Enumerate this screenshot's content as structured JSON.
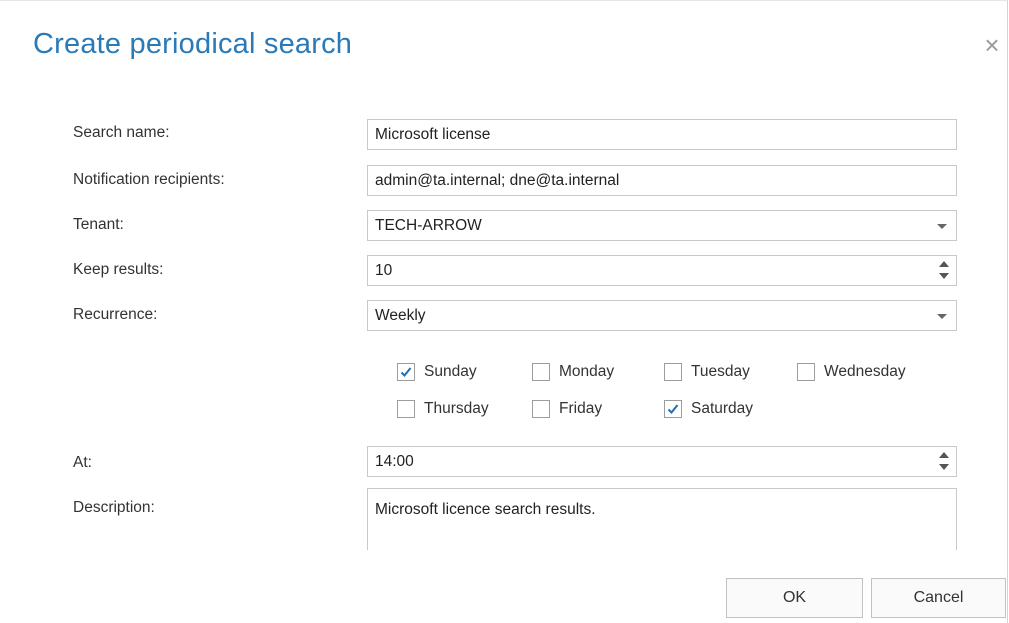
{
  "dialog": {
    "title": "Create periodical search",
    "close_glyph": "×"
  },
  "form": {
    "search_name": {
      "label": "Search name:",
      "value": "Microsoft license"
    },
    "recipients": {
      "label": "Notification recipients:",
      "value": "admin@ta.internal; dne@ta.internal"
    },
    "tenant": {
      "label": "Tenant:",
      "value": "TECH-ARROW"
    },
    "keep_results": {
      "label": "Keep results:",
      "value": "10"
    },
    "recurrence": {
      "label": "Recurrence:",
      "value": "Weekly"
    },
    "days": [
      {
        "label": "Sunday",
        "checked": true
      },
      {
        "label": "Monday",
        "checked": false
      },
      {
        "label": "Tuesday",
        "checked": false
      },
      {
        "label": "Wednesday",
        "checked": false
      },
      {
        "label": "Thursday",
        "checked": false
      },
      {
        "label": "Friday",
        "checked": false
      },
      {
        "label": "Saturday",
        "checked": true
      }
    ],
    "at": {
      "label": "At:",
      "value": "14:00"
    },
    "description": {
      "label": "Description:",
      "value": "Microsoft licence search results."
    }
  },
  "buttons": {
    "ok": "OK",
    "cancel": "Cancel"
  },
  "colors": {
    "title": "#2a7ab8",
    "check": "#1f6fb2",
    "border": "#c8c8c8"
  },
  "icons": {
    "close": "close-icon",
    "checkmark": "checkmark-icon",
    "dropdown": "chevron-down-icon",
    "spinner": "spinner-arrows-icon"
  }
}
